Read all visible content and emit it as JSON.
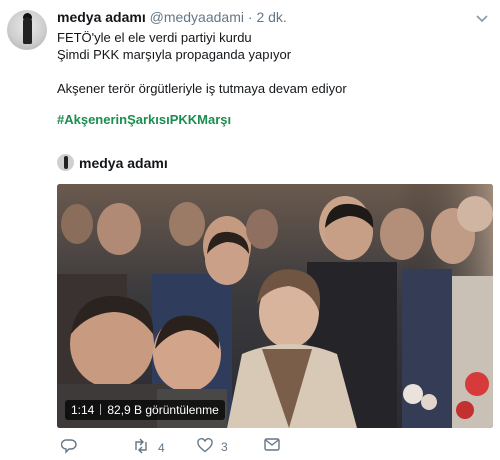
{
  "tweet": {
    "author_name": "medya adamı",
    "handle": "@medyaadami",
    "separator": "·",
    "time": "2 dk.",
    "lines": [
      "FETÖ'yle el ele verdi partiyi kurdu",
      "Şimdi PKK marşıyla propaganda yapıyor",
      "Akşener terör örgütleriyle iş tutmaya devam ediyor"
    ],
    "hashtag": "#AkşenerinŞarkısıPKKMarşı"
  },
  "embed": {
    "author_name": "medya adamı",
    "video": {
      "duration": "1:14",
      "views": "82,9 B görüntülenme"
    }
  },
  "actions": {
    "reply_icon": "reply-icon",
    "retweet_icon": "retweet-icon",
    "retweet_count": "4",
    "like_icon": "heart-icon",
    "like_count": "3",
    "dm_icon": "envelope-icon"
  },
  "colors": {
    "hashtag": "#1b8e4e",
    "muted": "#657786",
    "text": "#14171a"
  }
}
